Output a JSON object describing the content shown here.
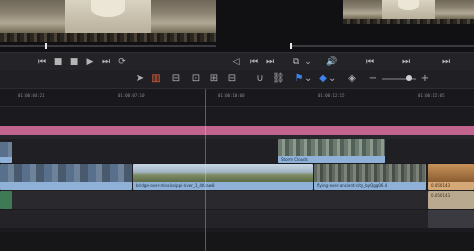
{
  "ruler": {
    "timecodes": [
      "01:00:04:21",
      "01:00:07:10",
      "01:00:10:00",
      "01:00:12:15",
      "01:00:15:05",
      "01:00:17:22"
    ]
  },
  "clips": {
    "v2_clip": "Storm Clouds",
    "v1_clip_a": "bridge-over-mississippi-river_1_4Kraw8",
    "v1_clip_b": "flying-over-ancient-city_byQgg06.4",
    "v1_clip_c": "0.050143",
    "a1_clip": "0.050143"
  },
  "icons": {
    "prev": "⏮",
    "stop": "■",
    "play": "▶",
    "next": "⏭",
    "loop": "⟳",
    "prog_prev": "⏮",
    "prog_next": "⏭",
    "prog_end": "⏭",
    "mark": "◁",
    "clear": "▷",
    "split": "⧉",
    "snap": "◻",
    "dropdown": "⌄",
    "volume": "🔊",
    "zoom_out": "−",
    "zoom_in": "+",
    "select": "➤",
    "blade": "▥",
    "trim": "⊟",
    "insert": "⊡",
    "overwrite": "⊞",
    "replace": "⊟",
    "lock": "🔒",
    "magnet": "∪",
    "link": "⛓",
    "flag": "⚑",
    "marker": "◆",
    "flag2": "◈"
  },
  "colors": {
    "accent": "#e8603c",
    "clip_blue": "#8fb1d8",
    "magenta": "#c2658e",
    "audio_green": "#3d7a55"
  }
}
